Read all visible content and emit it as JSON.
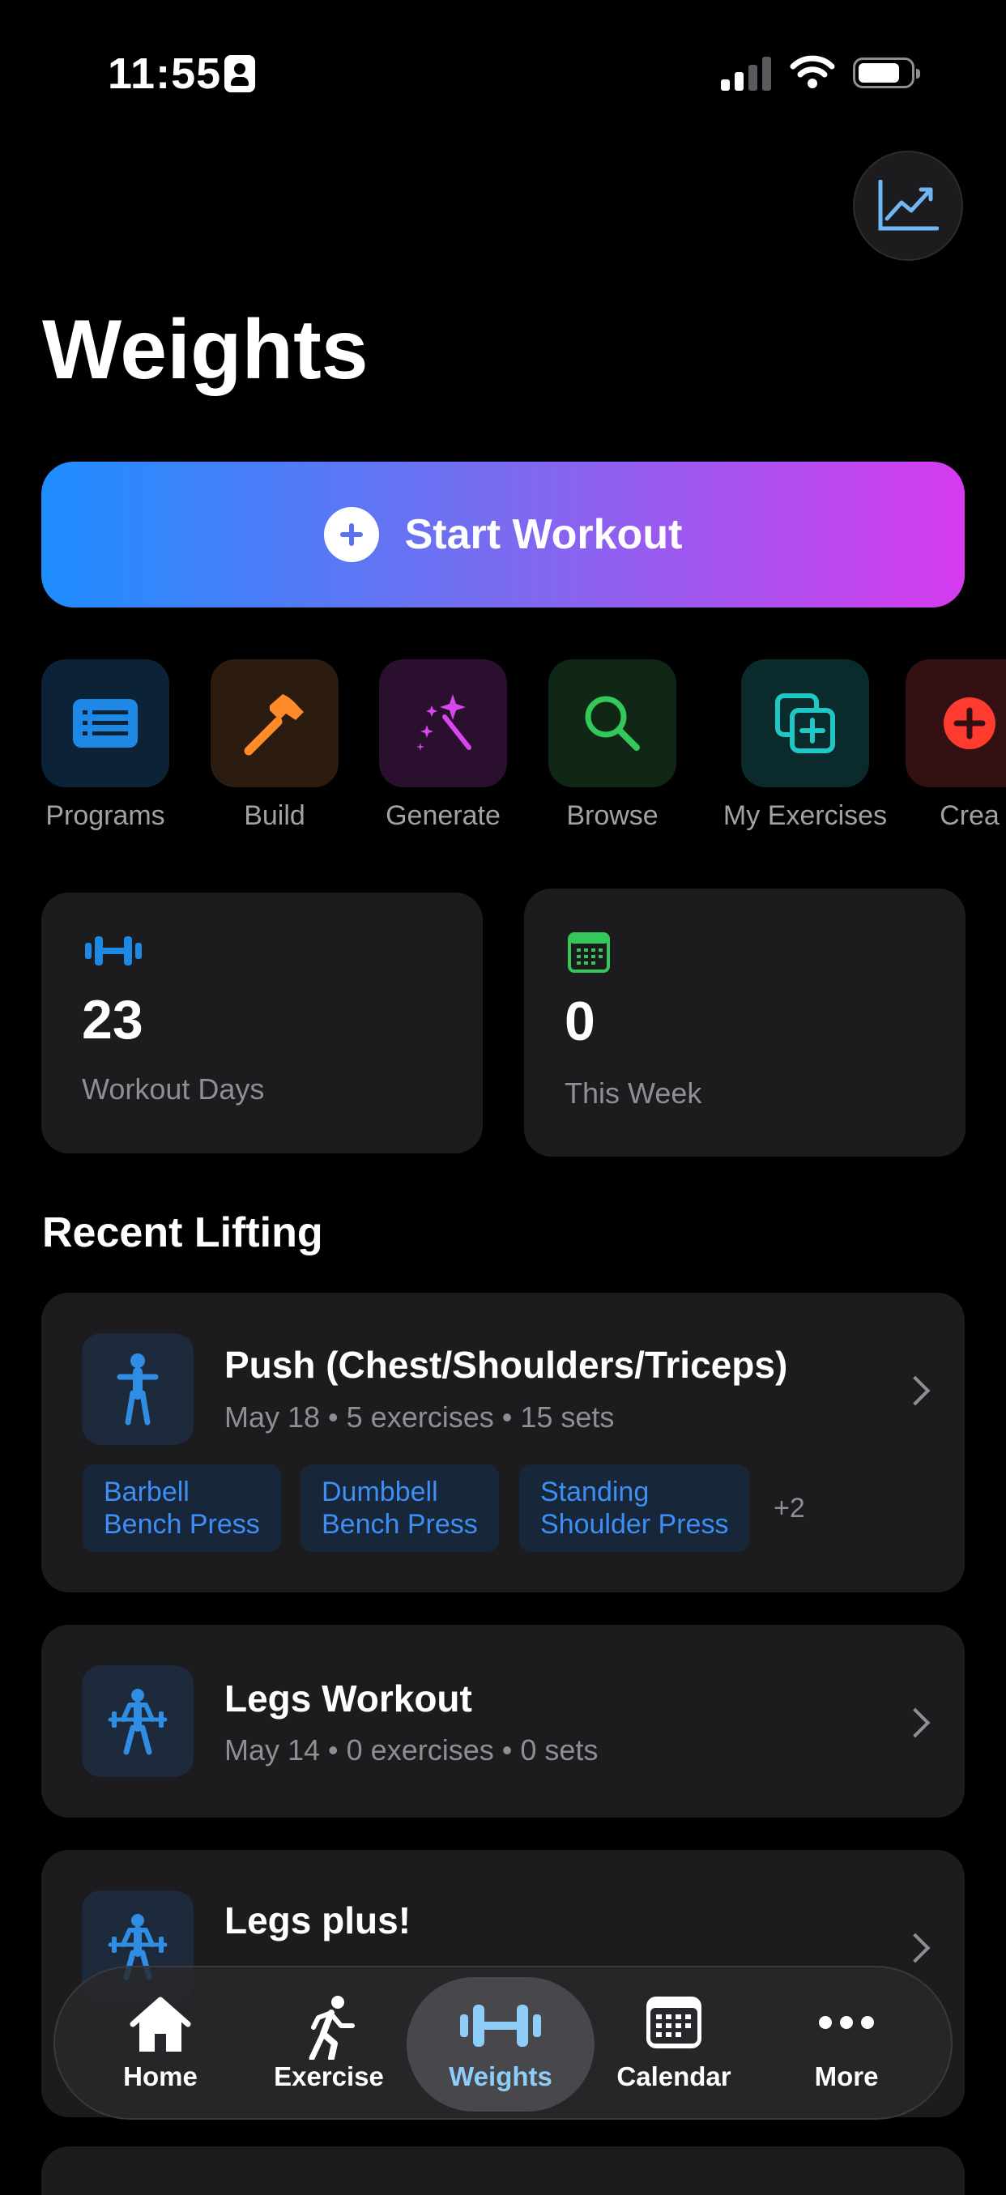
{
  "status_bar": {
    "time": "11:55"
  },
  "header": {
    "title": "Weights"
  },
  "start_workout": {
    "label": "Start Workout"
  },
  "quick_actions": [
    {
      "label": "Programs",
      "icon": "list-icon",
      "color": "#1e88e5"
    },
    {
      "label": "Build",
      "icon": "hammer-icon",
      "color": "#ff8a2a"
    },
    {
      "label": "Generate",
      "icon": "magic-wand-icon",
      "color": "#d946ef"
    },
    {
      "label": "Browse",
      "icon": "search-icon",
      "color": "#34c759"
    },
    {
      "label": "My Exercises",
      "icon": "add-square-icon",
      "color": "#1fc7c7"
    },
    {
      "label": "Crea",
      "icon": "add-circle-icon",
      "color": "#ff3b30"
    }
  ],
  "stats": [
    {
      "value": "23",
      "label": "Workout Days",
      "icon": "dumbbell-icon"
    },
    {
      "value": "0",
      "label": "This Week",
      "icon": "calendar-icon"
    }
  ],
  "recent": {
    "heading": "Recent Lifting",
    "items": [
      {
        "title": "Push (Chest/Shoulders/Triceps)",
        "meta": "May 18  •  5 exercises  •  15 sets",
        "icon": "person-icon",
        "tags": [
          {
            "line1": "Barbell",
            "line2": "Bench Press"
          },
          {
            "line1": "Dumbbell",
            "line2": "Bench Press"
          },
          {
            "line1": "Standing",
            "line2": "Shoulder Press"
          }
        ],
        "more": "+2"
      },
      {
        "title": "Legs Workout",
        "meta": "May 14  •  0 exercises  •  0 sets",
        "icon": "weightlifter-icon"
      },
      {
        "title": "Legs plus!",
        "icon": "weightlifter-icon"
      }
    ]
  },
  "tab_bar": [
    {
      "label": "Home",
      "icon": "home-icon"
    },
    {
      "label": "Exercise",
      "icon": "running-icon"
    },
    {
      "label": "Weights",
      "icon": "dumbbell-icon",
      "active": true
    },
    {
      "label": "Calendar",
      "icon": "calendar-icon"
    },
    {
      "label": "More",
      "icon": "ellipsis-icon"
    }
  ]
}
